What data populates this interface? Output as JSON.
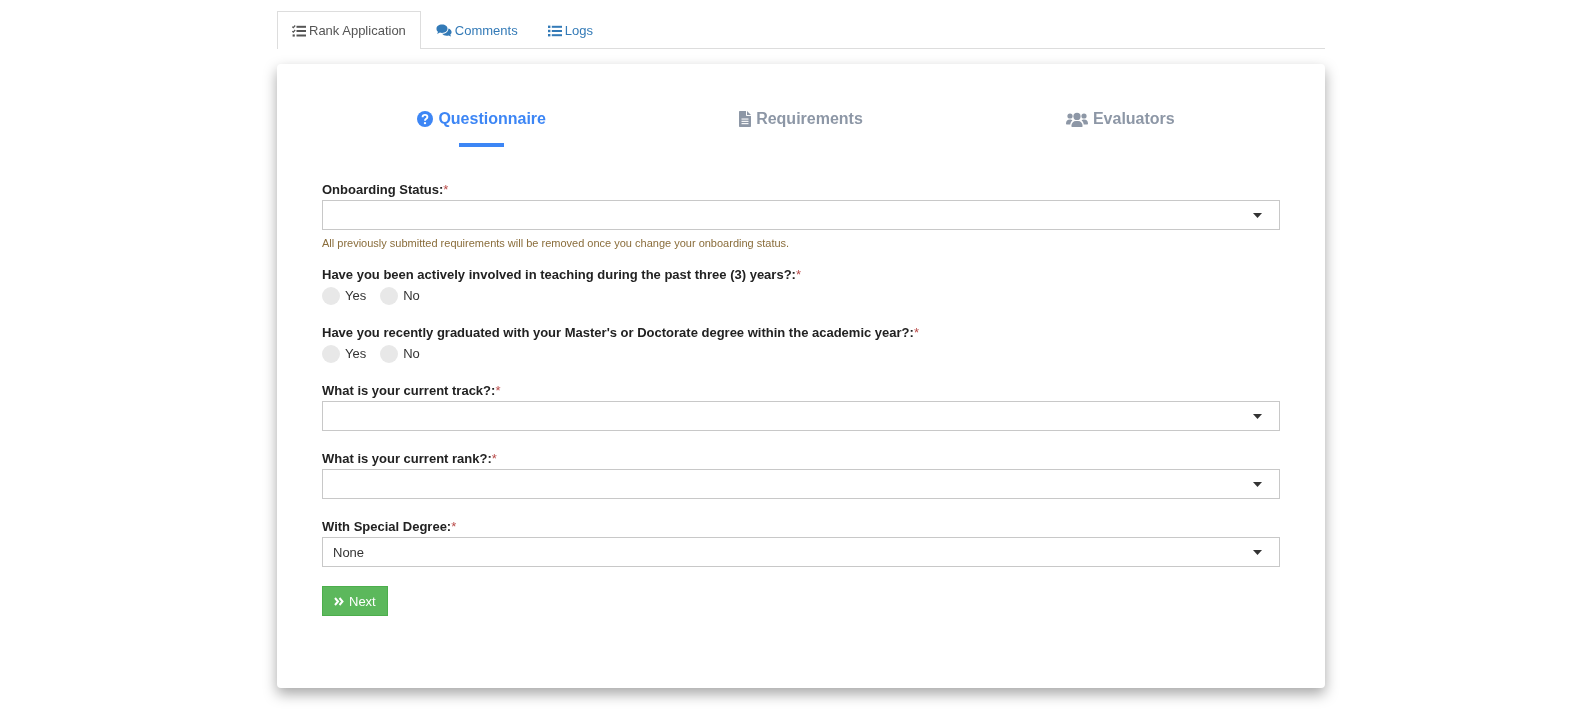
{
  "tabs": [
    {
      "label": "Rank Application",
      "selected": true
    },
    {
      "label": "Comments",
      "selected": false
    },
    {
      "label": "Logs",
      "selected": false
    }
  ],
  "steps": [
    {
      "label": "Questionnaire",
      "selected": true
    },
    {
      "label": "Requirements",
      "selected": false
    },
    {
      "label": "Evaluators",
      "selected": false
    }
  ],
  "form": {
    "fields": [
      {
        "kind": "select",
        "label": "Onboarding Status:",
        "required_mark": "*",
        "help": "All previously submitted requirements will be removed once you change your onboarding status."
      },
      {
        "kind": "radio",
        "label": "Have you been actively involved in teaching during the past three (3) years?:",
        "required_mark": "*",
        "options": [
          {
            "label": "Yes",
            "selected": false
          },
          {
            "label": "No",
            "selected": false
          }
        ]
      },
      {
        "kind": "radio",
        "label": "Have you recently graduated with your Master's or Doctorate degree within the academic year?:",
        "required_mark": "*",
        "options": [
          {
            "label": "Yes",
            "selected": false
          },
          {
            "label": "No",
            "selected": false
          }
        ]
      },
      {
        "kind": "select",
        "label": "What is your current track?:",
        "required_mark": "*"
      },
      {
        "kind": "select",
        "label": "What is your current rank?:",
        "required_mark": "*"
      },
      {
        "kind": "select",
        "label": "With Special Degree:",
        "required_mark": "*",
        "value": "None"
      }
    ],
    "next_button": {
      "label": "Next"
    }
  }
}
